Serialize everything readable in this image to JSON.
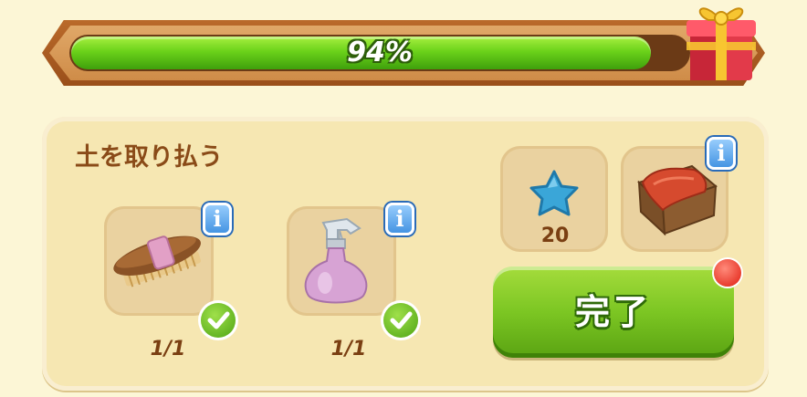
{
  "progress": {
    "percent_label": "94%",
    "value": 0.94
  },
  "task": {
    "title": "土を取り払う"
  },
  "required_items": [
    {
      "icon": "brush-icon",
      "count": "1/1",
      "done": true
    },
    {
      "icon": "spray-bottle-icon",
      "count": "1/1",
      "done": true
    }
  ],
  "rewards": [
    {
      "icon": "blue-star-icon",
      "amount": "20"
    },
    {
      "icon": "wooden-crate-icon"
    }
  ],
  "info_label": "i",
  "complete_button": {
    "label": "完了"
  },
  "colors": {
    "progress_fill": "#6bd21a",
    "button_green": "#7cc623",
    "title_brown": "#8a4b18",
    "notification_red": "#e01d10"
  }
}
